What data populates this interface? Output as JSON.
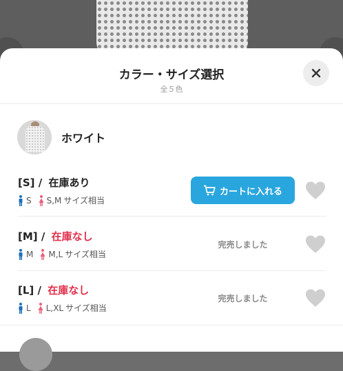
{
  "header": {
    "title": "カラー・サイズ選択",
    "subtitle": "全５色"
  },
  "color": {
    "name": "ホワイト"
  },
  "sizes": [
    {
      "label": "[S] /",
      "stock": "在庫あり",
      "male_size": "S",
      "female_size": "S,M",
      "fit_suffix": "サイズ相当",
      "action": "カートに入れる",
      "available": true
    },
    {
      "label": "[M] /",
      "stock": "在庫なし",
      "male_size": "M",
      "female_size": "M,L",
      "fit_suffix": "サイズ相当",
      "action": "完売しました",
      "available": false
    },
    {
      "label": "[L] /",
      "stock": "在庫なし",
      "male_size": "L",
      "female_size": "L,XL",
      "fit_suffix": "サイズ相当",
      "action": "完売しました",
      "available": false
    }
  ],
  "icons": {
    "close": "close-icon",
    "cart": "cart-icon",
    "heart": "heart-icon",
    "male": "male-person-icon",
    "female": "female-person-icon"
  },
  "colors": {
    "accent": "#2aa6de",
    "out_of_stock": "#e0304b",
    "male_icon": "#1d6fb8",
    "female_icon": "#e8607a",
    "heart": "#cfcfcf"
  }
}
